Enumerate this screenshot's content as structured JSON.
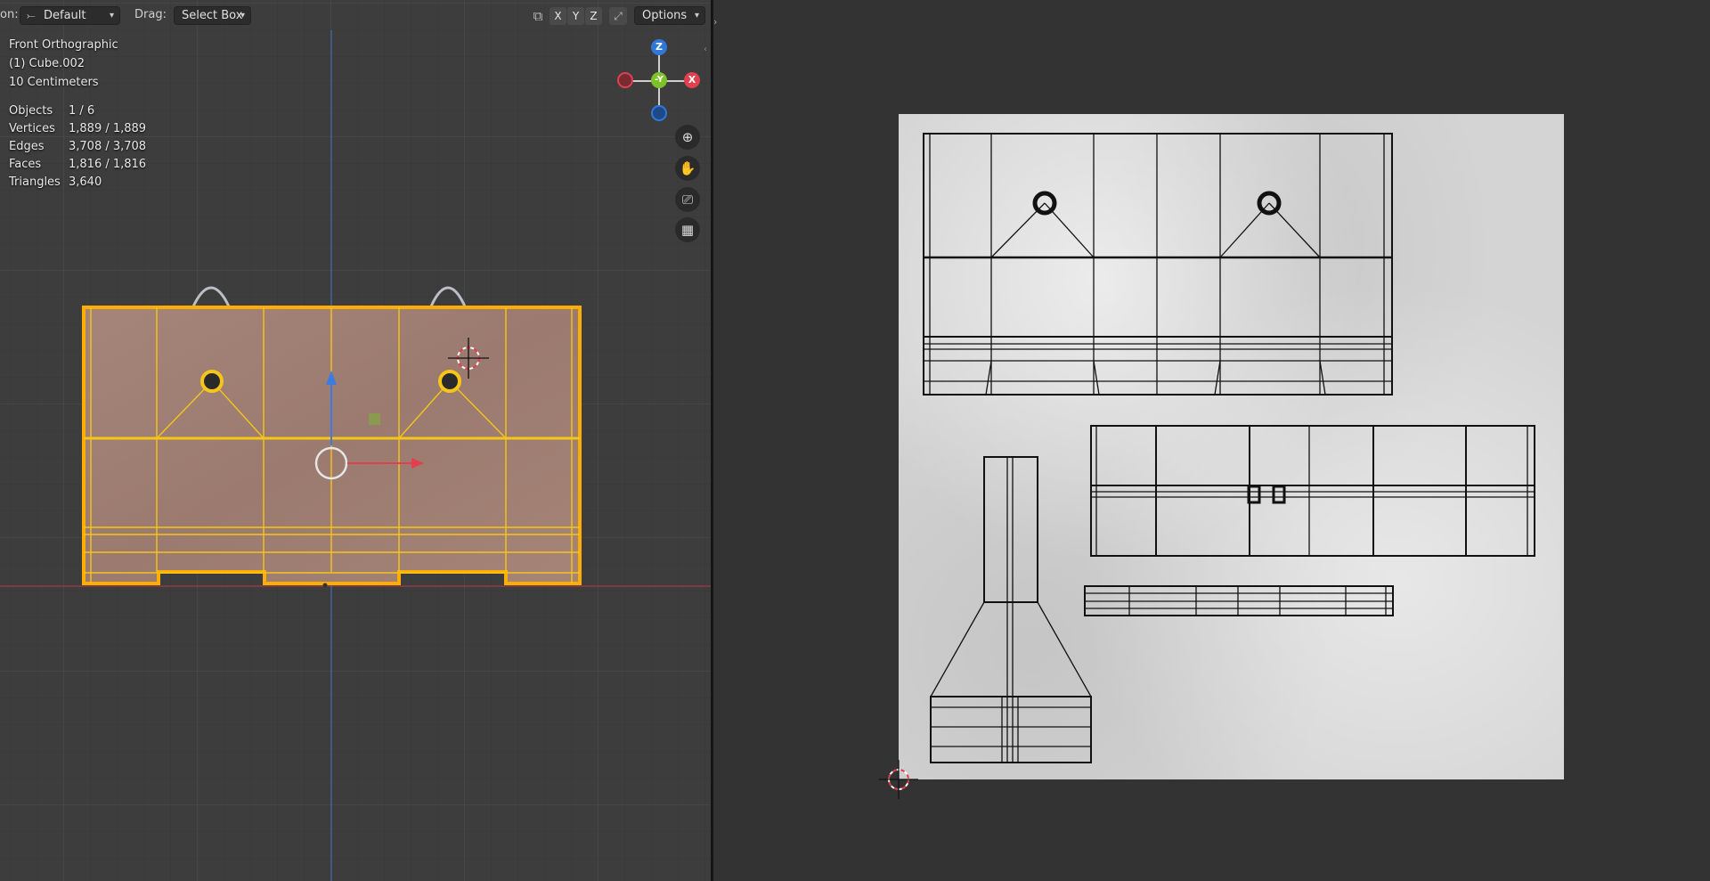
{
  "header": {
    "pivot_label_partial": "on:",
    "pivot_value": "Default",
    "drag_label": "Drag:",
    "drag_value": "Select Box",
    "axis_x": "X",
    "axis_y": "Y",
    "axis_z": "Z",
    "options_label": "Options"
  },
  "viewport_overlay": {
    "view_name": "Front Orthographic",
    "object_name": "(1) Cube.002",
    "grid_scale": "10 Centimeters"
  },
  "stats": {
    "objects_label": "Objects",
    "objects_value": "1 / 6",
    "vertices_label": "Vertices",
    "vertices_value": "1,889 / 1,889",
    "edges_label": "Edges",
    "edges_value": "3,708 / 3,708",
    "faces_label": "Faces",
    "faces_value": "1,816 / 1,816",
    "triangles_label": "Triangles",
    "triangles_value": "3,640"
  },
  "gizmo": {
    "z": "Z",
    "y": "-Y",
    "x": "X"
  },
  "colors": {
    "selection_outline": "#ffae00",
    "selected_edges": "#f5c518",
    "axis_x": "#e0404f",
    "axis_y": "#7ec22a",
    "axis_z": "#2f78d8",
    "uv_wire": "#111111"
  },
  "icons": {
    "zoom": "magnifier-plus-icon",
    "pan": "hand-icon",
    "camera": "camera-icon",
    "grid": "grid-icon",
    "cursor": "3d-cursor-icon"
  }
}
